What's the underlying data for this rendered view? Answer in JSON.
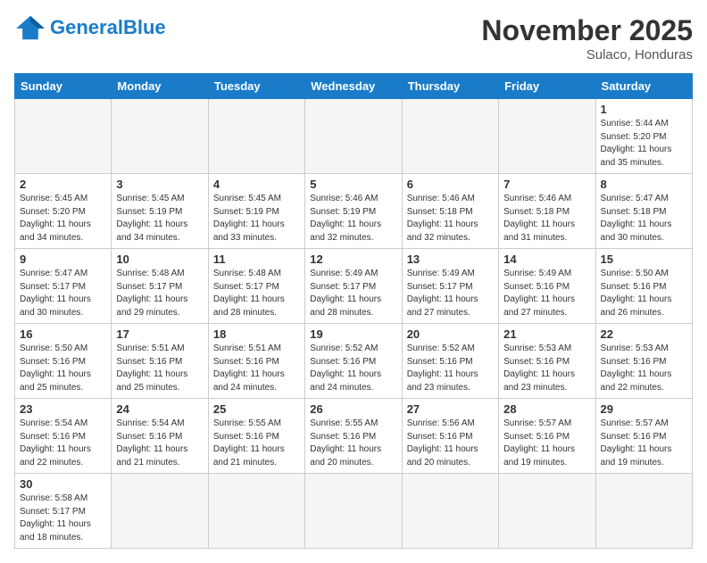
{
  "header": {
    "logo_general": "General",
    "logo_blue": "Blue",
    "month_title": "November 2025",
    "location": "Sulaco, Honduras"
  },
  "weekdays": [
    "Sunday",
    "Monday",
    "Tuesday",
    "Wednesday",
    "Thursday",
    "Friday",
    "Saturday"
  ],
  "days": [
    {
      "date": 1,
      "sunrise": "5:44 AM",
      "sunset": "5:20 PM",
      "daylight": "11 hours and 35 minutes."
    },
    {
      "date": 2,
      "sunrise": "5:45 AM",
      "sunset": "5:20 PM",
      "daylight": "11 hours and 34 minutes."
    },
    {
      "date": 3,
      "sunrise": "5:45 AM",
      "sunset": "5:19 PM",
      "daylight": "11 hours and 34 minutes."
    },
    {
      "date": 4,
      "sunrise": "5:45 AM",
      "sunset": "5:19 PM",
      "daylight": "11 hours and 33 minutes."
    },
    {
      "date": 5,
      "sunrise": "5:46 AM",
      "sunset": "5:19 PM",
      "daylight": "11 hours and 32 minutes."
    },
    {
      "date": 6,
      "sunrise": "5:46 AM",
      "sunset": "5:18 PM",
      "daylight": "11 hours and 32 minutes."
    },
    {
      "date": 7,
      "sunrise": "5:46 AM",
      "sunset": "5:18 PM",
      "daylight": "11 hours and 31 minutes."
    },
    {
      "date": 8,
      "sunrise": "5:47 AM",
      "sunset": "5:18 PM",
      "daylight": "11 hours and 30 minutes."
    },
    {
      "date": 9,
      "sunrise": "5:47 AM",
      "sunset": "5:17 PM",
      "daylight": "11 hours and 30 minutes."
    },
    {
      "date": 10,
      "sunrise": "5:48 AM",
      "sunset": "5:17 PM",
      "daylight": "11 hours and 29 minutes."
    },
    {
      "date": 11,
      "sunrise": "5:48 AM",
      "sunset": "5:17 PM",
      "daylight": "11 hours and 28 minutes."
    },
    {
      "date": 12,
      "sunrise": "5:49 AM",
      "sunset": "5:17 PM",
      "daylight": "11 hours and 28 minutes."
    },
    {
      "date": 13,
      "sunrise": "5:49 AM",
      "sunset": "5:17 PM",
      "daylight": "11 hours and 27 minutes."
    },
    {
      "date": 14,
      "sunrise": "5:49 AM",
      "sunset": "5:16 PM",
      "daylight": "11 hours and 27 minutes."
    },
    {
      "date": 15,
      "sunrise": "5:50 AM",
      "sunset": "5:16 PM",
      "daylight": "11 hours and 26 minutes."
    },
    {
      "date": 16,
      "sunrise": "5:50 AM",
      "sunset": "5:16 PM",
      "daylight": "11 hours and 25 minutes."
    },
    {
      "date": 17,
      "sunrise": "5:51 AM",
      "sunset": "5:16 PM",
      "daylight": "11 hours and 25 minutes."
    },
    {
      "date": 18,
      "sunrise": "5:51 AM",
      "sunset": "5:16 PM",
      "daylight": "11 hours and 24 minutes."
    },
    {
      "date": 19,
      "sunrise": "5:52 AM",
      "sunset": "5:16 PM",
      "daylight": "11 hours and 24 minutes."
    },
    {
      "date": 20,
      "sunrise": "5:52 AM",
      "sunset": "5:16 PM",
      "daylight": "11 hours and 23 minutes."
    },
    {
      "date": 21,
      "sunrise": "5:53 AM",
      "sunset": "5:16 PM",
      "daylight": "11 hours and 23 minutes."
    },
    {
      "date": 22,
      "sunrise": "5:53 AM",
      "sunset": "5:16 PM",
      "daylight": "11 hours and 22 minutes."
    },
    {
      "date": 23,
      "sunrise": "5:54 AM",
      "sunset": "5:16 PM",
      "daylight": "11 hours and 22 minutes."
    },
    {
      "date": 24,
      "sunrise": "5:54 AM",
      "sunset": "5:16 PM",
      "daylight": "11 hours and 21 minutes."
    },
    {
      "date": 25,
      "sunrise": "5:55 AM",
      "sunset": "5:16 PM",
      "daylight": "11 hours and 21 minutes."
    },
    {
      "date": 26,
      "sunrise": "5:55 AM",
      "sunset": "5:16 PM",
      "daylight": "11 hours and 20 minutes."
    },
    {
      "date": 27,
      "sunrise": "5:56 AM",
      "sunset": "5:16 PM",
      "daylight": "11 hours and 20 minutes."
    },
    {
      "date": 28,
      "sunrise": "5:57 AM",
      "sunset": "5:16 PM",
      "daylight": "11 hours and 19 minutes."
    },
    {
      "date": 29,
      "sunrise": "5:57 AM",
      "sunset": "5:16 PM",
      "daylight": "11 hours and 19 minutes."
    },
    {
      "date": 30,
      "sunrise": "5:58 AM",
      "sunset": "5:17 PM",
      "daylight": "11 hours and 18 minutes."
    }
  ],
  "labels": {
    "sunrise": "Sunrise:",
    "sunset": "Sunset:",
    "daylight": "Daylight:"
  }
}
